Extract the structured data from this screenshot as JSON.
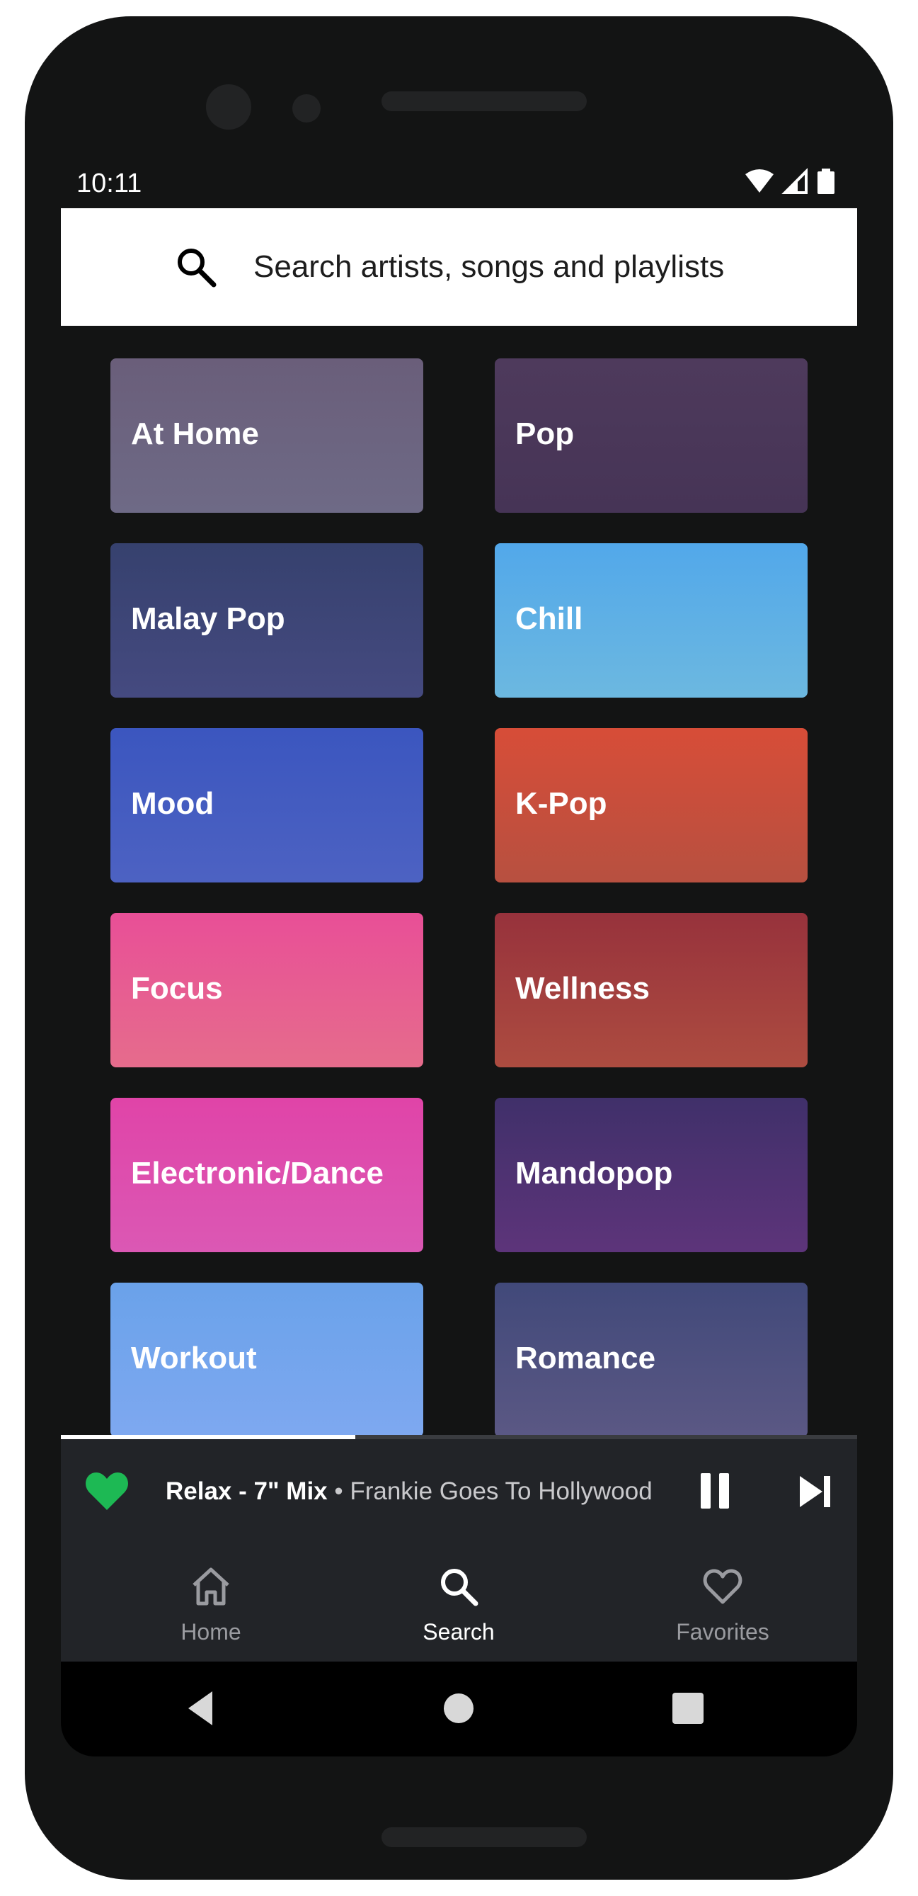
{
  "status_bar": {
    "time": "10:11"
  },
  "search": {
    "placeholder": "Search artists, songs and playlists"
  },
  "categories": [
    {
      "label": "At Home",
      "color_top": "#6a5e7a",
      "color_bottom": "#6e6a86"
    },
    {
      "label": "Pop",
      "color_top": "#4e3a5c",
      "color_bottom": "#463456"
    },
    {
      "label": "Malay Pop",
      "color_top": "#36416e",
      "color_bottom": "#454a80"
    },
    {
      "label": "Chill",
      "color_top": "#52a8ea",
      "color_bottom": "#6cb8e0"
    },
    {
      "label": "Mood",
      "color_top": "#3b56bf",
      "color_bottom": "#4d62c2"
    },
    {
      "label": "K-Pop",
      "color_top": "#d74d38",
      "color_bottom": "#b75040"
    },
    {
      "label": "Focus",
      "color_top": "#e84f97",
      "color_bottom": "#e66c8c"
    },
    {
      "label": "Wellness",
      "color_top": "#97323c",
      "color_bottom": "#ad4c40"
    },
    {
      "label": "Electronic/Dance",
      "color_top": "#e044a8",
      "color_bottom": "#db58b4"
    },
    {
      "label": "Mandopop",
      "color_top": "#40306a",
      "color_bottom": "#5d347a"
    },
    {
      "label": "Workout",
      "color_top": "#6aa2ea",
      "color_bottom": "#7ea8f0"
    },
    {
      "label": "Romance",
      "color_top": "#41497a",
      "color_bottom": "#5b5884"
    }
  ],
  "player": {
    "title": "Relax - 7\" Mix",
    "separator": " • ",
    "artist": "Frankie Goes To Hollywood",
    "progress_fraction": 0.37,
    "favorite_color": "#1db954"
  },
  "bottom_nav": {
    "items": [
      {
        "label": "Home",
        "icon": "home-icon",
        "active": false
      },
      {
        "label": "Search",
        "icon": "search-icon",
        "active": true
      },
      {
        "label": "Favorites",
        "icon": "heart-outline-icon",
        "active": false
      }
    ],
    "active_color": "#ffffff",
    "inactive_color": "#9a9ba0"
  }
}
